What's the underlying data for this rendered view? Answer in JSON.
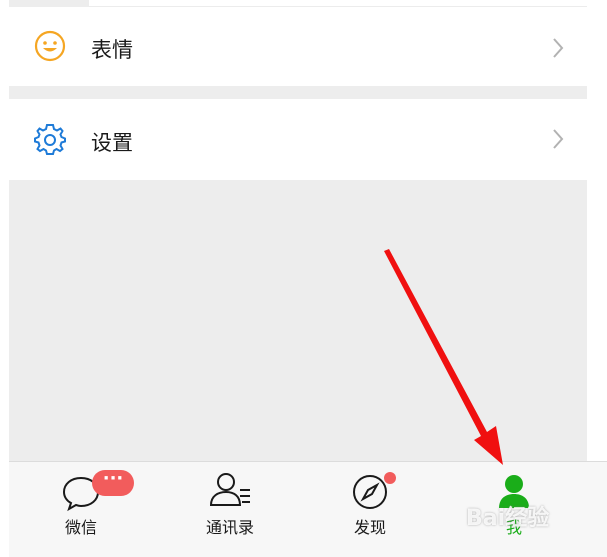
{
  "cells": [
    {
      "label": "表情",
      "icon": "smile-icon"
    },
    {
      "label": "设置",
      "icon": "gear-icon"
    }
  ],
  "tabs": [
    {
      "label": "微信",
      "icon": "chat-bubble-icon",
      "badge": "···"
    },
    {
      "label": "通讯录",
      "icon": "contacts-icon"
    },
    {
      "label": "发现",
      "icon": "compass-icon"
    },
    {
      "label": "我",
      "icon": "person-icon"
    }
  ],
  "watermark": "Bai经验",
  "colors": {
    "accent_green": "#1aad19",
    "badge_red": "#f25c5c",
    "icon_orange": "#f5a623",
    "icon_blue": "#1e7bd8",
    "annotation_red": "#f01010"
  }
}
